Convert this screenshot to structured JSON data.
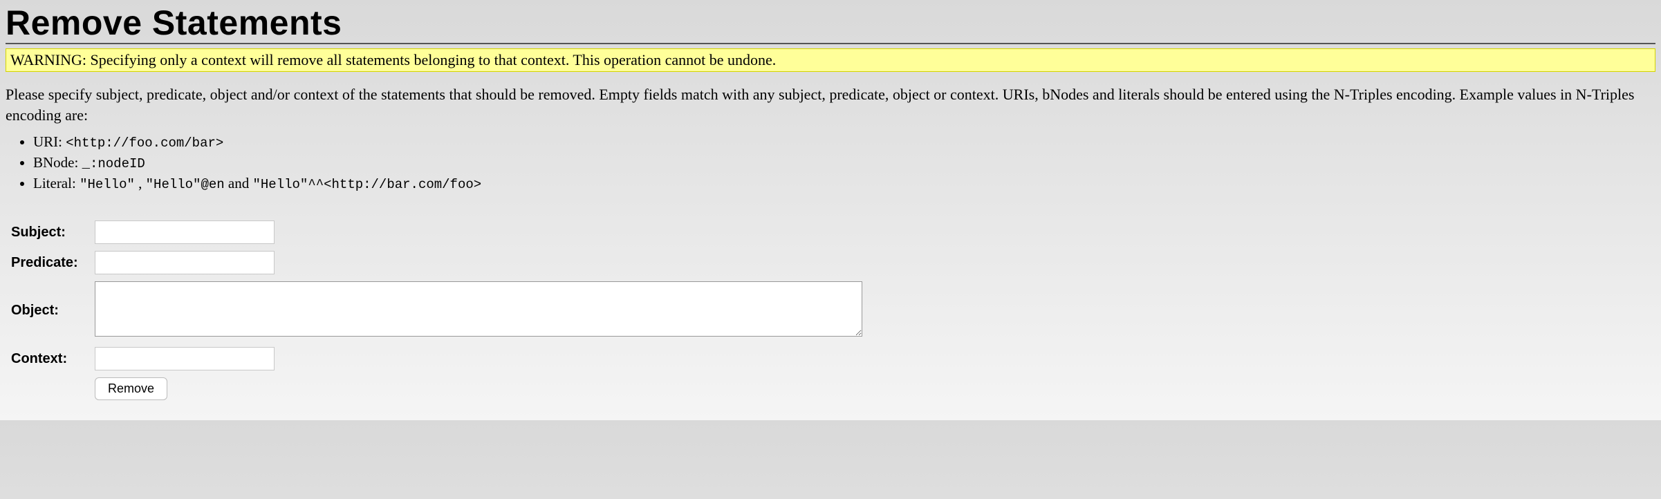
{
  "title": "Remove Statements",
  "warning": "WARNING: Specifying only a context will remove all statements belonging to that context. This operation cannot be undone.",
  "intro": "Please specify subject, predicate, object and/or context of the statements that should be removed. Empty fields match with any subject, predicate, object or context. URIs, bNodes and literals should be entered using the N-Triples encoding. Example values in N-Triples encoding are:",
  "examples": {
    "uri_label": "URI: ",
    "uri_code": "<http://foo.com/bar>",
    "bnode_label": "BNode: ",
    "bnode_code": "_:nodeID",
    "literal_label": "Literal: ",
    "literal_code1": "\"Hello\"",
    "literal_sep1": " , ",
    "literal_code2": "\"Hello\"@en",
    "literal_sep2": " and ",
    "literal_code3": "\"Hello\"^^<http://bar.com/foo>"
  },
  "form": {
    "subject_label": "Subject:",
    "subject_value": "",
    "predicate_label": "Predicate:",
    "predicate_value": "",
    "object_label": "Object:",
    "object_value": "",
    "context_label": "Context:",
    "context_value": "",
    "submit_label": "Remove"
  }
}
